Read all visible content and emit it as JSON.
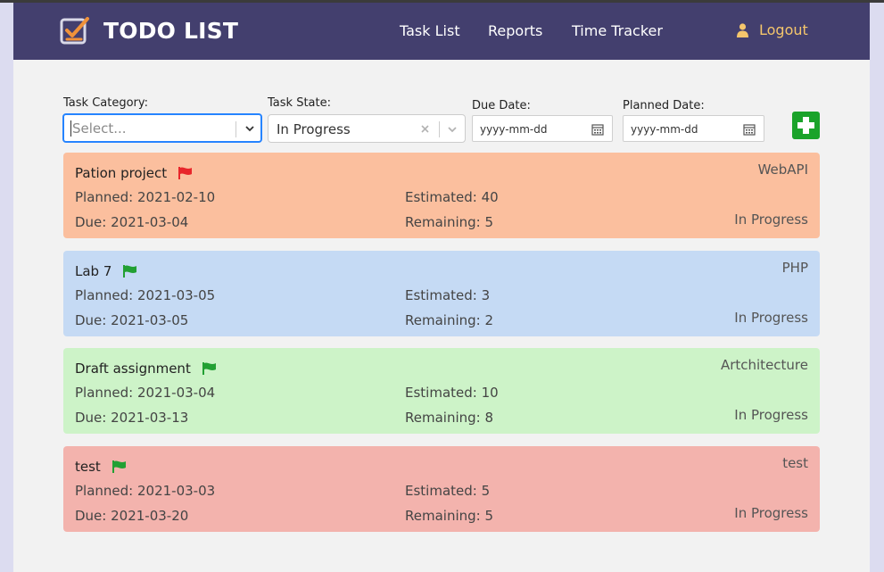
{
  "app": {
    "brand": "TODO LIST"
  },
  "nav": {
    "links": [
      "Task List",
      "Reports",
      "Time Tracker"
    ],
    "logout": "Logout"
  },
  "filters": {
    "category_label": "Task Category:",
    "category_placeholder": "Select...",
    "state_label": "Task State:",
    "state_value": "In Progress",
    "due_label": "Due Date:",
    "due_placeholder": "yyyy-mm-dd",
    "planned_label": "Planned Date:",
    "planned_placeholder": "yyyy-mm-dd"
  },
  "colors": {
    "navbar": "#433f6e",
    "brand_accent": "#f0923a",
    "flag_red": "#e8262b",
    "flag_green": "#22a033",
    "add_button": "#1aa32a"
  },
  "tasks": [
    {
      "title": "Pation project",
      "flag": "red-flag-icon",
      "category": "WebAPI",
      "planned": "Planned: 2021-02-10",
      "due": "Due: 2021-03-04",
      "estimated": "Estimated: 40",
      "remaining": "Remaining: 5",
      "state": "In Progress",
      "color": "#fbbf9e"
    },
    {
      "title": "Lab 7",
      "flag": "green-flag-icon",
      "category": "PHP",
      "planned": "Planned: 2021-03-05",
      "due": "Due: 2021-03-05",
      "estimated": "Estimated: 3",
      "remaining": "Remaining: 2",
      "state": "In Progress",
      "color": "#c5daf4"
    },
    {
      "title": "Draft assignment",
      "flag": "green-flag-icon",
      "category": "Artchitecture",
      "planned": "Planned: 2021-03-04",
      "due": "Due: 2021-03-13",
      "estimated": "Estimated: 10",
      "remaining": "Remaining: 8",
      "state": "In Progress",
      "color": "#cdf3c8"
    },
    {
      "title": "test",
      "flag": "green-flag-icon",
      "category": "test",
      "planned": "Planned: 2021-03-03",
      "due": "Due: 2021-03-20",
      "estimated": "Estimated: 5",
      "remaining": "Remaining: 5",
      "state": "In Progress",
      "color": "#f3b3ad"
    }
  ]
}
